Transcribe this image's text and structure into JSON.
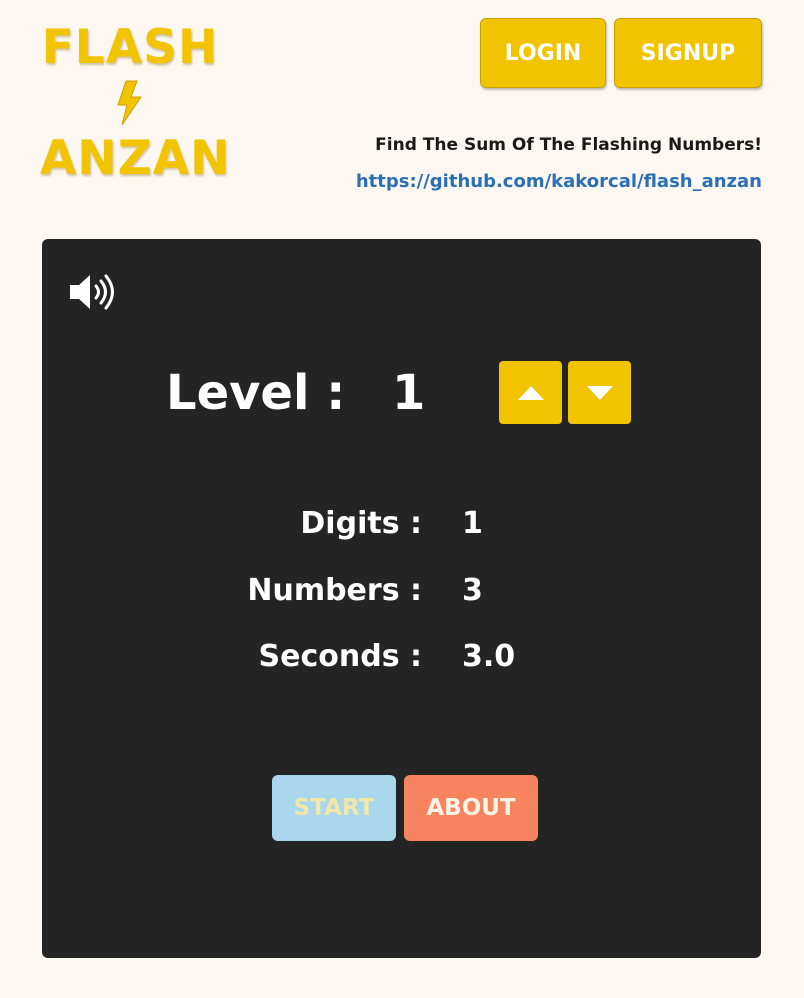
{
  "logo": {
    "line1": "FLASH",
    "line2": "ANZAN",
    "bolt_icon": "lightning-bolt-icon",
    "color": "#f2c400"
  },
  "header": {
    "login_label": "LOGIN",
    "signup_label": "SIGNUP",
    "tagline": "Find The Sum Of The Flashing Numbers!",
    "repo_link": "https://github.com/kakorcal/flash_anzan"
  },
  "game": {
    "sound_icon": "speaker-volume-icon",
    "level_label": "Level :",
    "level_value": "1",
    "level_up_icon": "triangle-up-icon",
    "level_down_icon": "triangle-down-icon",
    "stats": {
      "digits_label": "Digits :",
      "digits_value": "1",
      "numbers_label": "Numbers :",
      "numbers_value": "3",
      "seconds_label": "Seconds :",
      "seconds_value": "3.0"
    },
    "start_label": "START",
    "about_label": "ABOUT"
  },
  "colors": {
    "page_background": "#fcf8f1",
    "panel_background": "#242424",
    "accent_yellow": "#f2c400",
    "start_blue": "#a9d8ee",
    "about_orange": "#f7845f",
    "link_blue": "#2c6fb5"
  }
}
